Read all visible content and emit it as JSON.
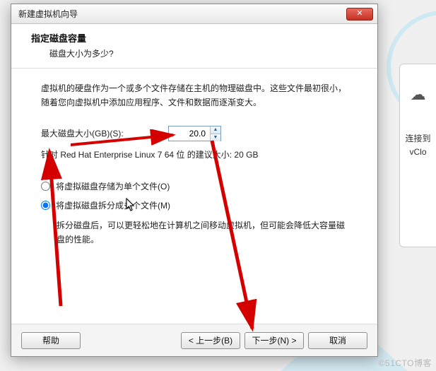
{
  "dialog": {
    "title": "新建虚拟机向导",
    "header_title": "指定磁盘容量",
    "header_subtitle": "磁盘大小为多少?",
    "description": "虚拟机的硬盘作为一个或多个文件存储在主机的物理磁盘中。这些文件最初很小，随着您向虚拟机中添加应用程序、文件和数据而逐渐变大。",
    "max_disk_label": "最大磁盘大小(GB)(S):",
    "max_disk_value": "20.0",
    "recommend_text": "针对 Red Hat Enterprise Linux 7 64 位 的建议大小: 20 GB",
    "radio_single": "将虚拟磁盘存储为单个文件(O)",
    "radio_split": "将虚拟磁盘拆分成多个文件(M)",
    "split_note": "拆分磁盘后，可以更轻松地在计算机之间移动虚拟机，但可能会降低大容量磁盘的性能。",
    "btn_help": "帮助",
    "btn_back": "< 上一步(B)",
    "btn_next": "下一步(N) >",
    "btn_cancel": "取消"
  },
  "side": {
    "line1": "连接到",
    "line2": "vClo"
  },
  "watermark": "©51CTO博客"
}
